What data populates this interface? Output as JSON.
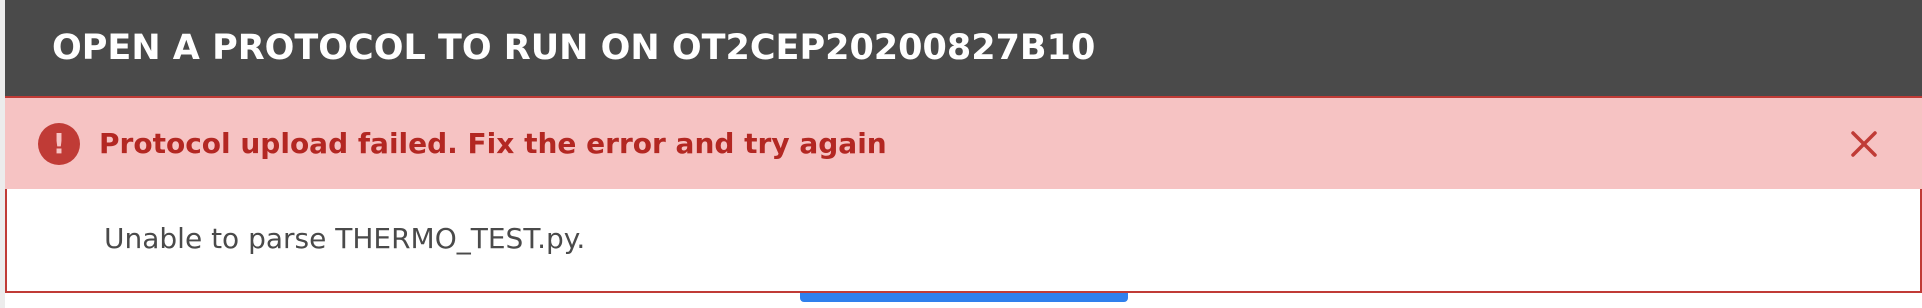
{
  "header": {
    "title": "OPEN A PROTOCOL TO RUN ON OT2CEP20200827B10"
  },
  "alert": {
    "icon": "exclamation-circle-icon",
    "icon_glyph": "!",
    "message": "Protocol upload failed. Fix the error and try again",
    "close_icon": "close-icon",
    "color_background": "#f6c3c3",
    "color_text": "#b32722",
    "color_accent": "#c03b36"
  },
  "content": {
    "error_detail": "Unable to parse THERMO_TEST.py."
  },
  "colors": {
    "header_background": "#4a4a4a",
    "primary_button": "#2f80ed"
  }
}
